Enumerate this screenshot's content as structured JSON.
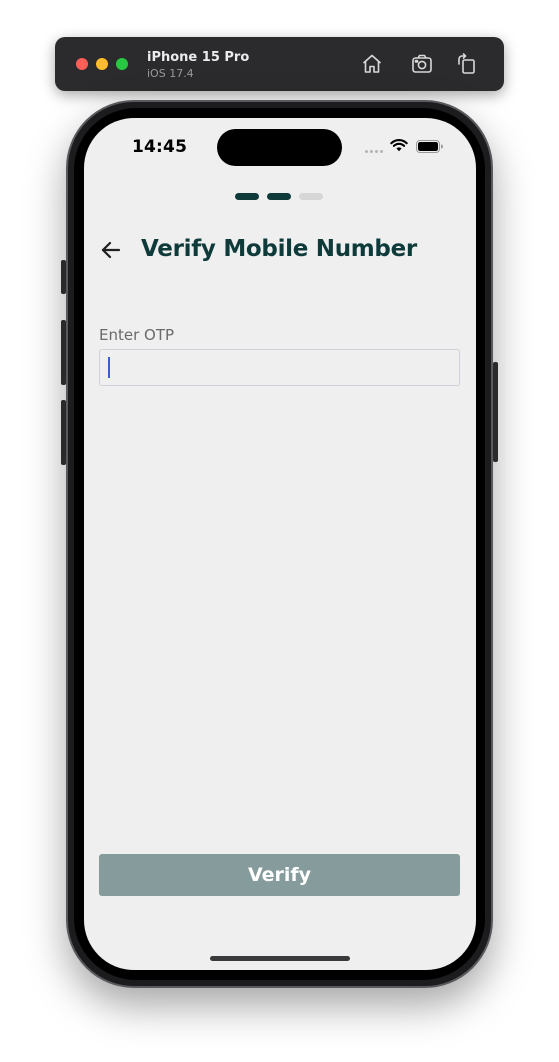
{
  "simulator": {
    "device_name": "iPhone 15 Pro",
    "os_version": "iOS 17.4",
    "icons": {
      "home": "home-icon",
      "screenshot": "screenshot-icon",
      "rotate": "rotate-icon"
    }
  },
  "status_bar": {
    "time": "14:45",
    "icons": [
      "cellular-signal-icon",
      "wifi-icon",
      "battery-icon"
    ]
  },
  "stepper": {
    "total_steps": 3,
    "active_steps": 2,
    "active_color": "#0e3a3a",
    "inactive_color": "#d6d6d6"
  },
  "header": {
    "back_icon": "arrow-left-icon",
    "title": "Verify Mobile Number"
  },
  "form": {
    "otp_label": "Enter OTP",
    "otp_value": "",
    "otp_placeholder": ""
  },
  "actions": {
    "verify_label": "Verify",
    "verify_color": "#869c9c"
  },
  "colors": {
    "brand_dark": "#0e3a3a",
    "screen_background": "#efefef",
    "caret": "#3d5bd9"
  }
}
